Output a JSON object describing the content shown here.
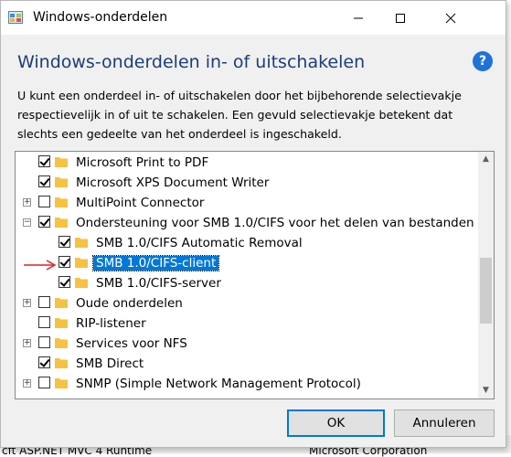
{
  "backdrop": {
    "left_text": "cft ASP.NET MVC 4 Runtime",
    "right_text": "Microsoft Corporation"
  },
  "window": {
    "title": "Windows-onderdelen",
    "controls": {
      "minimize": "—",
      "maximize": "☐",
      "close": "✕"
    }
  },
  "header": {
    "heading": "Windows-onderdelen in- of uitschakelen",
    "help_label": "?"
  },
  "description": "U kunt een onderdeel in- of uitschakelen door het bijbehorende selectievakje respectievelijk in of uit te schakelen. Een gevuld selectievakje betekent dat slechts een gedeelte van het onderdeel is ingeschakeld.",
  "features": [
    {
      "label": "Microsoft Print to PDF",
      "level": 0,
      "expander": "",
      "state": "checked"
    },
    {
      "label": "Microsoft XPS Document Writer",
      "level": 0,
      "expander": "",
      "state": "checked"
    },
    {
      "label": "MultiPoint Connector",
      "level": 0,
      "expander": "+",
      "state": "unchecked"
    },
    {
      "label": "Ondersteuning voor SMB 1.0/CIFS voor het delen van bestanden",
      "level": 0,
      "expander": "−",
      "state": "checked"
    },
    {
      "label": "SMB 1.0/CIFS Automatic Removal",
      "level": 1,
      "expander": "",
      "state": "checked"
    },
    {
      "label": "SMB 1.0/CIFS-client",
      "level": 1,
      "expander": "",
      "state": "checked",
      "selected": true
    },
    {
      "label": "SMB 1.0/CIFS-server",
      "level": 1,
      "expander": "",
      "state": "checked"
    },
    {
      "label": "Oude onderdelen",
      "level": 0,
      "expander": "+",
      "state": "unchecked"
    },
    {
      "label": "RIP-listener",
      "level": 0,
      "expander": "",
      "state": "unchecked"
    },
    {
      "label": "Services voor NFS",
      "level": 0,
      "expander": "+",
      "state": "unchecked"
    },
    {
      "label": "SMB Direct",
      "level": 0,
      "expander": "",
      "state": "checked"
    },
    {
      "label": "SNMP (Simple Network Management Protocol)",
      "level": 0,
      "expander": "+",
      "state": "unchecked"
    }
  ],
  "buttons": {
    "ok": "OK",
    "cancel": "Annuleren"
  },
  "colors": {
    "accent": "#0078d7",
    "heading": "#1c3d79",
    "annotation_arrow": "#e02020",
    "folder": "#f5c242"
  }
}
